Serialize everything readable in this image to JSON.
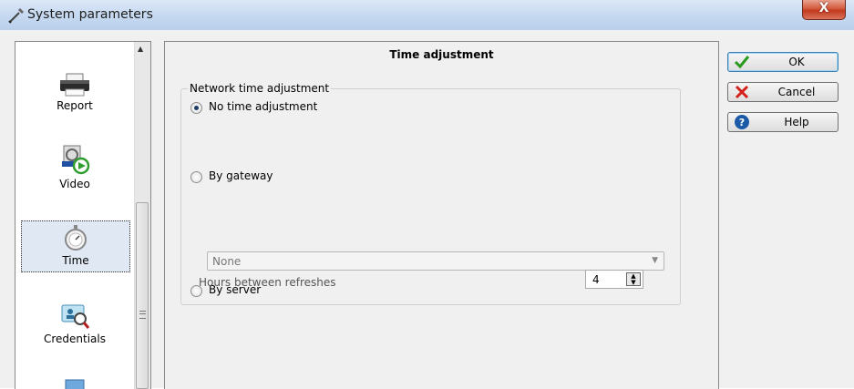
{
  "window": {
    "title": "System parameters",
    "close_glyph": "X"
  },
  "sidebar": {
    "items": [
      {
        "label": "Report",
        "icon": "printer-icon"
      },
      {
        "label": "Video",
        "icon": "video-icon"
      },
      {
        "label": "Time",
        "icon": "stopwatch-icon",
        "selected": true
      },
      {
        "label": "Credentials",
        "icon": "credentials-icon"
      },
      {
        "label": "",
        "icon": "monitor-icon"
      }
    ]
  },
  "panel": {
    "title": "Time adjustment",
    "group_label": "Network time adjustment",
    "options": [
      {
        "label": "No time adjustment",
        "checked": true
      },
      {
        "label": "By gateway",
        "checked": false
      },
      {
        "label": "By server",
        "checked": false
      }
    ],
    "gateway_select": {
      "value": "None"
    },
    "hours_label": "Hours between refreshes",
    "hours_value": "4"
  },
  "buttons": {
    "ok": "OK",
    "cancel": "Cancel",
    "help": "Help"
  },
  "colors": {
    "ok_check": "#2a9a1f",
    "cancel_x": "#d4201a",
    "help_blue": "#1c5aa8",
    "title_bar": "#c7daf1"
  }
}
